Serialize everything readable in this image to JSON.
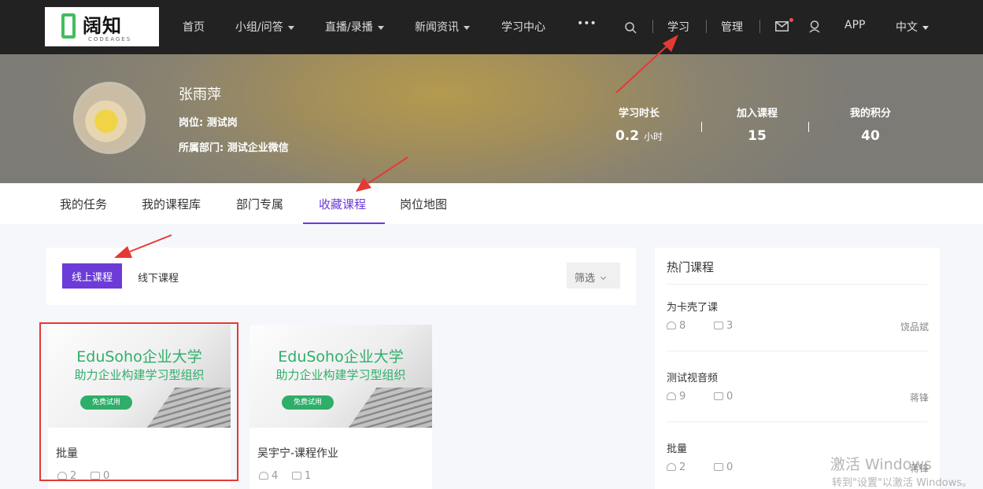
{
  "brand": {
    "name_zh": "阔知",
    "name_en": "CODEAGES"
  },
  "nav": {
    "items": [
      {
        "label": "首页",
        "dropdown": false
      },
      {
        "label": "小组/问答",
        "dropdown": true
      },
      {
        "label": "直播/录播",
        "dropdown": true
      },
      {
        "label": "新闻资讯",
        "dropdown": true
      },
      {
        "label": "学习中心",
        "dropdown": false
      },
      {
        "label": "•••",
        "dropdown": false
      }
    ],
    "study": "学习",
    "manage": "管理",
    "app": "APP",
    "language": "中文"
  },
  "profile": {
    "name": "张雨萍",
    "position": "岗位: 测试岗",
    "department": "所属部门: 测试企业微信",
    "stats": [
      {
        "label": "学习时长",
        "value": "0.2",
        "unit": "小时"
      },
      {
        "label": "加入课程",
        "value": "15",
        "unit": ""
      },
      {
        "label": "我的积分",
        "value": "40",
        "unit": ""
      }
    ]
  },
  "tabs": [
    {
      "label": "我的任务",
      "active": false
    },
    {
      "label": "我的课程库",
      "active": false
    },
    {
      "label": "部门专属",
      "active": false
    },
    {
      "label": "收藏课程",
      "active": true
    },
    {
      "label": "岗位地图",
      "active": false
    }
  ],
  "filters": {
    "online": "线上课程",
    "offline": "线下课程",
    "filter": "筛选"
  },
  "course_thumb": {
    "line1": "EduSoho企业大学",
    "line2": "助力企业构建学习型组织",
    "badge": "免费试用"
  },
  "courses": [
    {
      "title": "批量",
      "students": "2",
      "comments": "0"
    },
    {
      "title": "吴宇宁-课程作业",
      "students": "4",
      "comments": "1"
    }
  ],
  "hot": {
    "title": "热门课程",
    "items": [
      {
        "title": "为卡壳了课",
        "students": "8",
        "comments": "3",
        "author": "饶品斌"
      },
      {
        "title": "测试视音频",
        "students": "9",
        "comments": "0",
        "author": "蒋锋"
      },
      {
        "title": "批量",
        "students": "2",
        "comments": "0",
        "author": "蒋锋"
      }
    ]
  },
  "watermark": {
    "line1": "激活 Windows",
    "line2": "转到\"设置\"以激活 Windows。"
  },
  "colors": {
    "accent": "#6c3bd8",
    "annotation": "#e53935",
    "nav_bg": "#222222"
  }
}
